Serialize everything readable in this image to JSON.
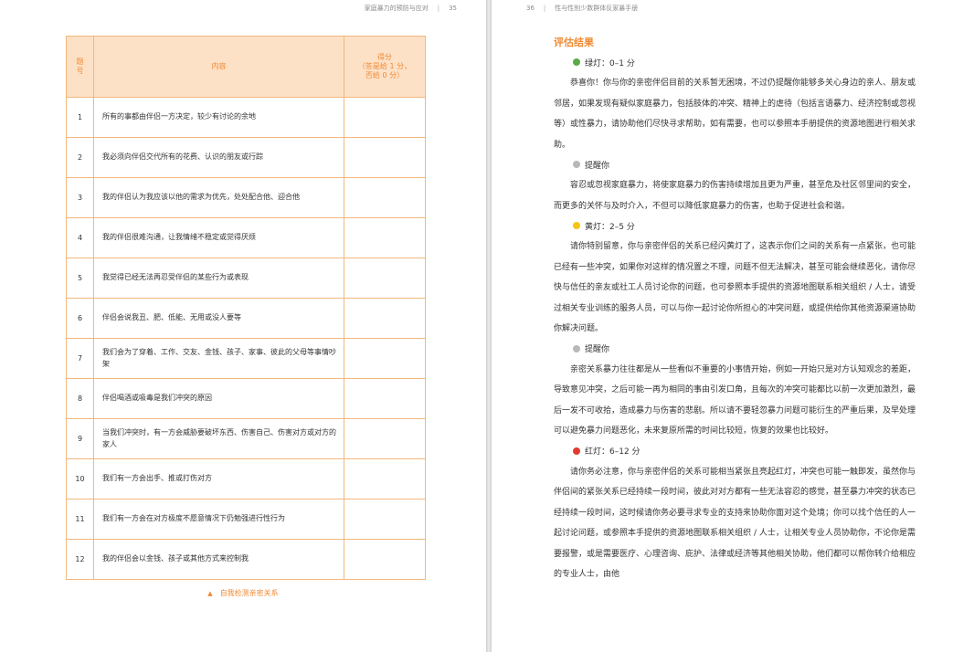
{
  "left_page": {
    "running_head": {
      "title": "家庭暴力的预防与应对",
      "page_number": "35"
    },
    "table": {
      "headers": {
        "number": "题\n号",
        "content": "内容",
        "score": "得分\n（答是给 1 分，\n否给 0 分）"
      },
      "rows": [
        {
          "num": "1",
          "text": "所有的事都由伴侣一方决定，较少有讨论的余地",
          "score": ""
        },
        {
          "num": "2",
          "text": "我必须向伴侣交代所有的花费、认识的朋友或行踪",
          "score": ""
        },
        {
          "num": "3",
          "text": "我的伴侣认为我应该以他的需求为优先，处处配合他、迎合他",
          "score": ""
        },
        {
          "num": "4",
          "text": "我的伴侣很难沟通，让我情绪不稳定或觉得厌烦",
          "score": ""
        },
        {
          "num": "5",
          "text": "我觉得已经无法再忍受伴侣的某些行为或表现",
          "score": ""
        },
        {
          "num": "6",
          "text": "伴侣会说我丑、肥、低能、无用或没人要等",
          "score": ""
        },
        {
          "num": "7",
          "text": "我们会为了穿着、工作、交友、金钱、孩子、家事、彼此的父母等事情吵架",
          "score": ""
        },
        {
          "num": "8",
          "text": "伴侣喝酒或吸毒是我们冲突的原因",
          "score": ""
        },
        {
          "num": "9",
          "text": "当我们冲突时，有一方会威胁要破坏东西、伤害自己、伤害对方或对方的家人",
          "score": ""
        },
        {
          "num": "10",
          "text": "我们有一方会出手、推或打伤对方",
          "score": ""
        },
        {
          "num": "11",
          "text": "我们有一方会在对方极度不愿意情况下仍勉强进行性行为",
          "score": ""
        },
        {
          "num": "12",
          "text": "我的伴侣会以金钱、孩子或其他方式来控制我",
          "score": ""
        }
      ]
    },
    "caption": {
      "icon": "triangle-icon",
      "text": "自我检测亲密关系"
    }
  },
  "right_page": {
    "running_head": {
      "page_number": "36",
      "title": "性与性别少数群体反家暴手册"
    },
    "section_title": "评估结果",
    "blocks": [
      {
        "type": "level",
        "color": "#5aaa4a",
        "text": "绿灯：0–1 分"
      },
      {
        "type": "para",
        "text": "恭喜你！你与你的亲密伴侣目前的关系暂无困境，不过仍提醒你能够多关心身边的亲人、朋友或邻居，如果发现有疑似家庭暴力，包括肢体的冲突、精神上的虐待（包括言语暴力、经济控制或忽视等）或性暴力，请协助他们尽快寻求帮助，如有需要，也可以参照本手册提供的资源地图进行相关求助。"
      },
      {
        "type": "level",
        "color": "#b8b8b8",
        "text": "提醒你"
      },
      {
        "type": "para",
        "text": "容忍或忽视家庭暴力，将使家庭暴力的伤害持续增加且更为严重，甚至危及社区邻里间的安全，而更多的关怀与及时介入，不但可以降低家庭暴力的伤害，也助于促进社会和谐。"
      },
      {
        "type": "level",
        "color": "#f5c518",
        "text": "黄灯：2–5 分"
      },
      {
        "type": "para",
        "text": "请你特别留意，你与亲密伴侣的关系已经闪黄灯了，这表示你们之间的关系有一点紧张，也可能已经有一些冲突，如果你对这样的情况置之不理，问题不但无法解决，甚至可能会继续恶化，请你尽快与信任的亲友或社工人员讨论你的问题，也可参照本手提供的资源地图联系相关组织 / 人士，请受过相关专业训练的服务人员，可以与你一起讨论你所担心的冲突问题，或提供给你其他资源渠道协助你解决问题。"
      },
      {
        "type": "level",
        "color": "#b8b8b8",
        "text": "提醒你"
      },
      {
        "type": "para",
        "text": "亲密关系暴力往往都是从一些看似不重要的小事情开始，例如一开始只是对方认知观念的差距，导致意见冲突，之后可能一再为相同的事由引发口角，且每次的冲突可能都比以前一次更加激烈，最后一发不可收拾，造成暴力与伤害的悲剧。所以请不要轻忽暴力问题可能衍生的严重后果，及早处理可以避免暴力问题恶化，未来复原所需的时间比较短，恢复的效果也比较好。"
      },
      {
        "type": "level",
        "color": "#e23b2e",
        "text": "红灯：6–12 分"
      },
      {
        "type": "para",
        "text": "请你务必注意，你与亲密伴侣的关系可能相当紧张且亮起红灯，冲突也可能一触即发，虽然你与伴侣间的紧张关系已经持续一段时间，彼此对对方都有一些无法容忍的感觉，甚至暴力冲突的状态已经持续一段时间，这时候请你务必要寻求专业的支持来协助你面对这个处境；你可以找个信任的人一起讨论问题，或参照本手提供的资源地图联系相关组织 / 人士，让相关专业人员协助你，不论你是需要报警，或是需要医疗、心理咨询、庇护、法律或经济等其他相关协助，他们都可以帮你转介给相应的专业人士，由他"
      }
    ]
  }
}
